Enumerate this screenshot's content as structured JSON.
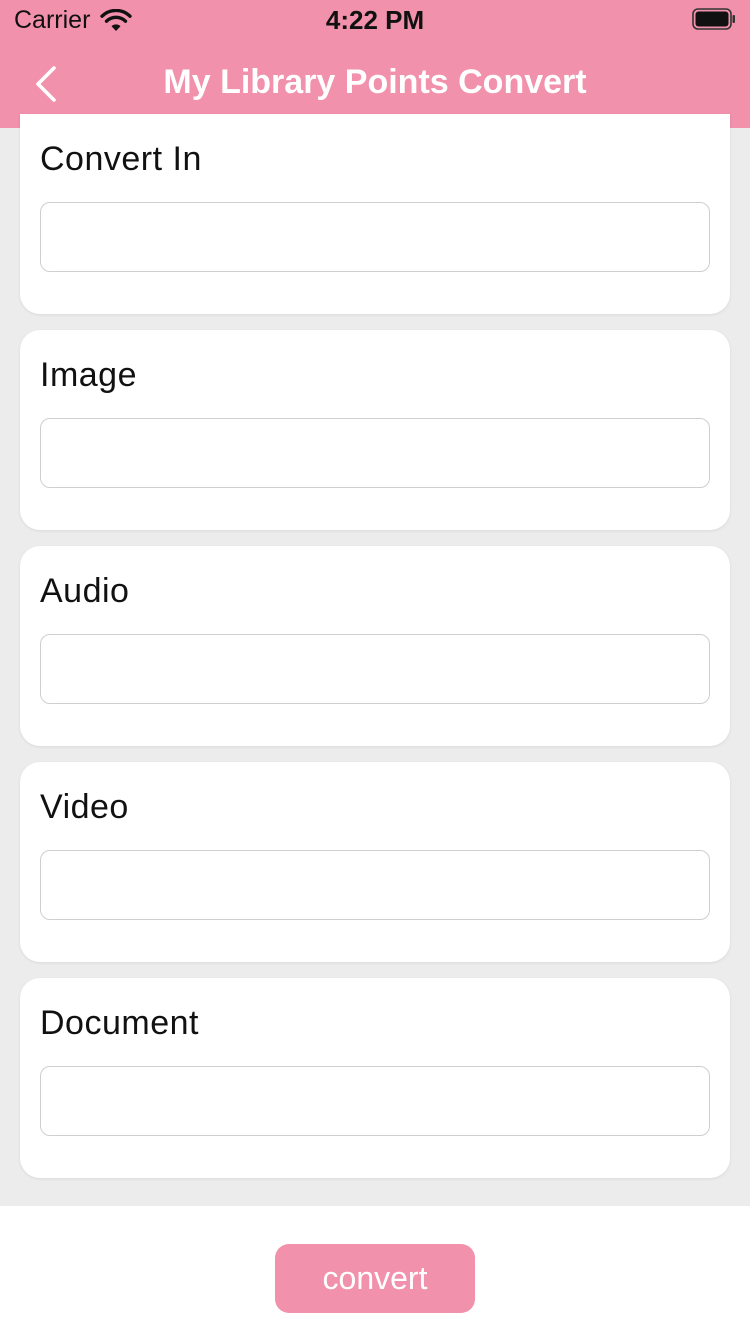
{
  "status_bar": {
    "carrier": "Carrier",
    "time": "4:22 PM"
  },
  "nav": {
    "title": "My Library Points Convert",
    "back_icon": "chevron-left-icon"
  },
  "form": {
    "fields": [
      {
        "label": "Convert In",
        "value": "",
        "placeholder": ""
      },
      {
        "label": "Image",
        "value": "",
        "placeholder": ""
      },
      {
        "label": "Audio",
        "value": "",
        "placeholder": ""
      },
      {
        "label": "Video",
        "value": "",
        "placeholder": ""
      },
      {
        "label": "Document",
        "value": "",
        "placeholder": ""
      }
    ],
    "submit_label": "convert"
  },
  "colors": {
    "accent": "#f191ac",
    "background": "#ececec",
    "card": "#ffffff"
  }
}
